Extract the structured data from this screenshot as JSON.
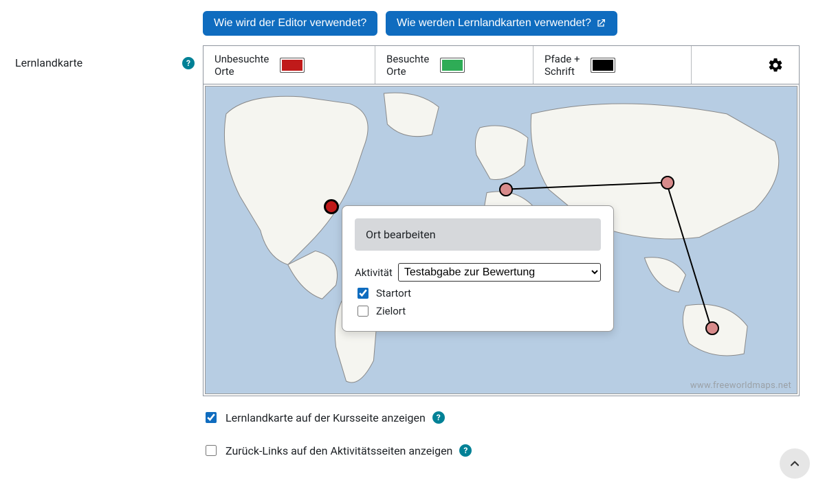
{
  "buttons": {
    "how_editor": "Wie wird der Editor verwendet?",
    "how_maps": "Wie werden Lernlandkarten verwendet?"
  },
  "section_label": "Lernlandkarte",
  "toolbar": {
    "unvisited": "Unbesuchte Orte",
    "visited": "Besuchte Orte",
    "paths": "Pfade + Schrift",
    "colors": {
      "unvisited": "#c01a1a",
      "visited": "#2eac56",
      "paths": "#000000"
    }
  },
  "popup": {
    "title": "Ort bearbeiten",
    "activity_label": "Aktivität",
    "activity_value": "Testabgabe zur Bewertung",
    "start_label": "Startort",
    "start_checked": true,
    "target_label": "Zielort",
    "target_checked": false
  },
  "map_credit": "www.freeworldmaps.net",
  "checkboxes": {
    "show_on_course": {
      "label": "Lernlandkarte auf der Kursseite anzeigen",
      "checked": true
    },
    "back_links": {
      "label": "Zurück-Links auf den Aktivitätsseiten anzeigen",
      "checked": false
    }
  }
}
